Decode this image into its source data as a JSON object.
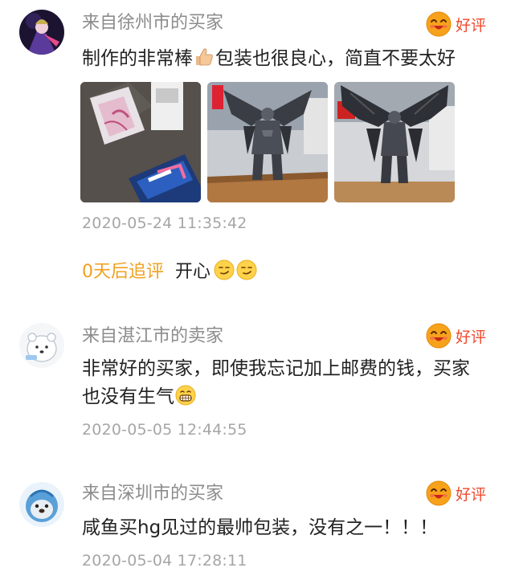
{
  "reviews": [
    {
      "reviewer": "来自徐州市的买家",
      "rating": "好评",
      "content": "制作的非常棒",
      "content_after_emoji": "包装也很良心，简直不要太好",
      "photo_icons": [
        "package-photo",
        "gundam-front-photo",
        "gundam-wings-photo"
      ],
      "timestamp": "2020-05-24 11:35:42",
      "followup": {
        "label": "0天后追评",
        "text": "开心"
      }
    },
    {
      "reviewer": "来自湛江市的卖家",
      "rating": "好评",
      "content": "非常好的买家，即使我忘记加上邮费的钱，买家也没有生气",
      "timestamp": "2020-05-05 12:44:55"
    },
    {
      "reviewer": "来自深圳市的买家",
      "rating": "好评",
      "content": "咸鱼买hg见过的最帅包装，没有之一！！！",
      "timestamp": "2020-05-04 17:28:11"
    }
  ],
  "colors": {
    "rating": "#f04a2e",
    "followup_label": "#f0a020",
    "reviewer": "#8c8c8c",
    "timestamp": "#a6a6a6"
  }
}
